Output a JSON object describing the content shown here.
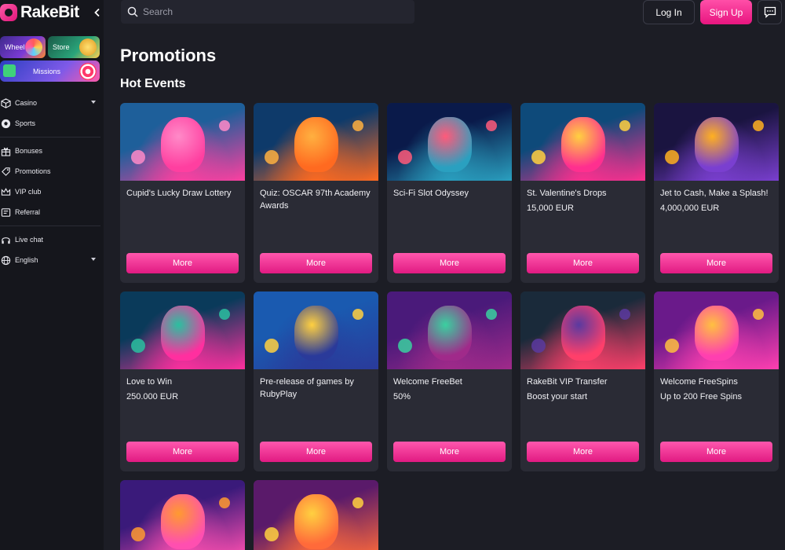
{
  "brand": {
    "name": "RakeBit"
  },
  "search": {
    "placeholder": "Search"
  },
  "header": {
    "login": "Log In",
    "signup": "Sign Up"
  },
  "sidebar": {
    "tiles": {
      "wheel": "Wheel",
      "store": "Store",
      "missions": "Missions"
    },
    "items": [
      {
        "label": "Casino",
        "icon": "dice-icon",
        "has_caret": true
      },
      {
        "label": "Sports",
        "icon": "soccer-ball-icon",
        "has_caret": false
      },
      {
        "label": "Bonuses",
        "icon": "gift-icon",
        "has_caret": false
      },
      {
        "label": "Promotions",
        "icon": "tag-icon",
        "has_caret": false
      },
      {
        "label": "VIP club",
        "icon": "crown-icon",
        "has_caret": false
      },
      {
        "label": "Referral",
        "icon": "user-plus-icon",
        "has_caret": false
      },
      {
        "label": "Live chat",
        "icon": "headset-icon",
        "has_caret": false
      },
      {
        "label": "English",
        "icon": "globe-icon",
        "has_caret": true
      }
    ]
  },
  "main": {
    "title": "Promotions",
    "section": "Hot Events",
    "more_label": "More",
    "cards": [
      {
        "title": "Cupid's Lucky Draw Lottery",
        "subtitle": "",
        "art": [
          "#1e5f9a",
          "#ff3fa0",
          "#ff8ac8"
        ]
      },
      {
        "title": "Quiz: OSCAR 97th Academy Awards",
        "subtitle": "",
        "art": [
          "#0e3a6a",
          "#ff6a20",
          "#ffb040"
        ]
      },
      {
        "title": "Sci-Fi Slot Odyssey",
        "subtitle": "",
        "art": [
          "#0a1a4a",
          "#2aa0c0",
          "#ff5a7a"
        ]
      },
      {
        "title": "St. Valentine's Drops",
        "subtitle": "15,000 EUR",
        "art": [
          "#0e4a7a",
          "#ff2f8f",
          "#ffd040"
        ]
      },
      {
        "title": "Jet to Cash, Make a Splash!",
        "subtitle": "4,000,000 EUR",
        "art": [
          "#1a1440",
          "#7a3fd0",
          "#ffb020"
        ]
      },
      {
        "title": "Love to Win",
        "subtitle": "250.000 EUR",
        "art": [
          "#0a3a5a",
          "#ff2f9f",
          "#2ac0a0"
        ]
      },
      {
        "title": "Pre-release of games by RubyPlay",
        "subtitle": "",
        "art": [
          "#1a5ab0",
          "#2a3a9a",
          "#ffd040"
        ]
      },
      {
        "title": "Welcome FreeBet",
        "subtitle": "50%",
        "art": [
          "#4a1a7a",
          "#a02a8a",
          "#3ad0a0"
        ]
      },
      {
        "title": "RakeBit VIP Transfer",
        "subtitle": "Boost your start",
        "art": [
          "#1a2a3a",
          "#ff3f6a",
          "#5a3aa0"
        ]
      },
      {
        "title": "Welcome FreeSpins",
        "subtitle": "Up to 200 Free Spins",
        "art": [
          "#6a1a8a",
          "#ff3fb0",
          "#ffc040"
        ]
      },
      {
        "title": "",
        "subtitle": "",
        "art": [
          "#3a1a7a",
          "#ff4fb0",
          "#ff9a30"
        ]
      },
      {
        "title": "",
        "subtitle": "",
        "art": [
          "#5a1a6a",
          "#ff6a3a",
          "#ffd040"
        ]
      }
    ]
  },
  "colors": {
    "accent": "#ee2a8c",
    "bg": "#1c1d25",
    "card": "#2a2b35",
    "sidebar": "#15161c"
  }
}
